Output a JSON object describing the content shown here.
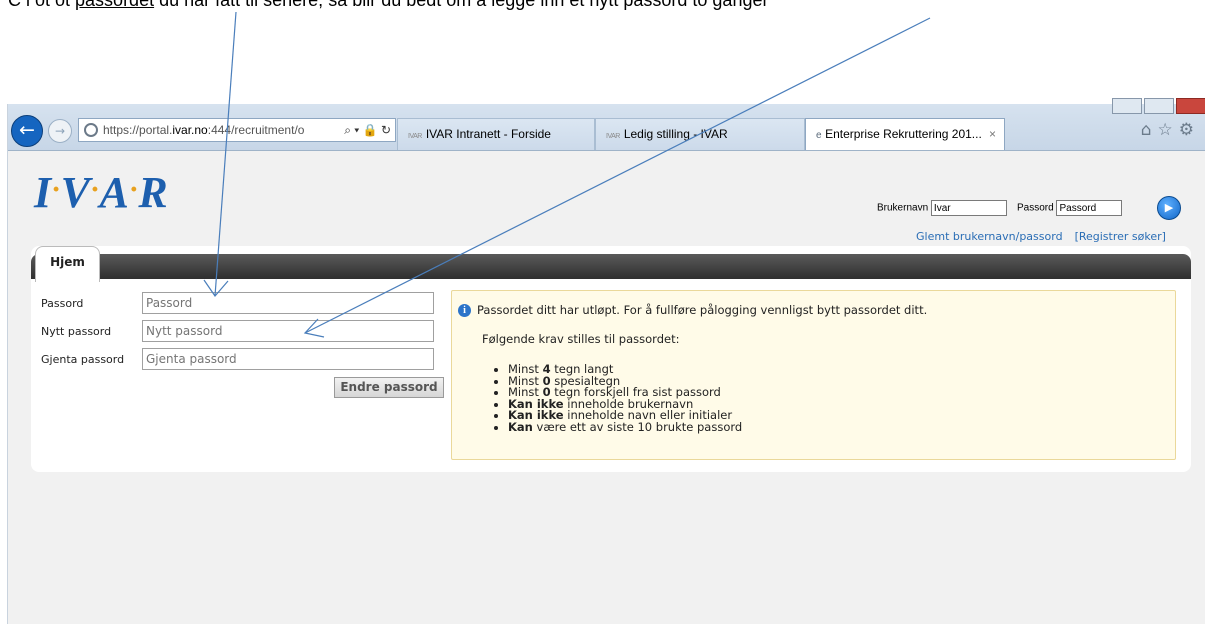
{
  "caption": {
    "before": "C     i     ot ot ",
    "underlined": "passordet",
    "after": " du har fått til senere, så blir du bedt om å legge inn et nytt passord to ganger"
  },
  "browser": {
    "address_prefix": "https://portal.",
    "address_host": "ivar.no",
    "address_suffix": ":444/recruitment/o",
    "address_icons": "⌕ ▾ 🔒 ↻",
    "tabs": [
      {
        "favicon": "IVAR",
        "label": "IVAR Intranett - Forside"
      },
      {
        "favicon": "IVAR",
        "label": "Ledig stilling - IVAR"
      },
      {
        "favicon": "e",
        "label": "Enterprise Rekruttering 201...",
        "close": "×"
      }
    ],
    "toolbar_icons": "⌂☆⚙"
  },
  "header": {
    "logo": [
      "I",
      "V",
      "A",
      "R"
    ],
    "login": {
      "username_label": "Brukernavn",
      "username_value": "Ivar",
      "password_label": "Passord",
      "password_value": "Passord"
    },
    "forgot_link": "Glemt brukernavn/passord",
    "register_link": "[Registrer søker]"
  },
  "nav": {
    "home_tab": "Hjem"
  },
  "form": {
    "fields": [
      {
        "label": "Passord",
        "placeholder": "Passord"
      },
      {
        "label": "Nytt passord",
        "placeholder": "Nytt passord"
      },
      {
        "label": "Gjenta passord",
        "placeholder": "Gjenta passord"
      }
    ],
    "submit": "Endre passord"
  },
  "notice": {
    "icon": "i",
    "message": "Passordet ditt har utløpt. For å fullføre pålogging vennligst bytt passordet ditt.",
    "requirements_title": "Følgende krav stilles til passordet:",
    "requirements": [
      {
        "pre": "Minst ",
        "bold": "4",
        "post": " tegn langt"
      },
      {
        "pre": "Minst ",
        "bold": "0",
        "post": " spesialtegn"
      },
      {
        "pre": "Minst ",
        "bold": "0",
        "post": " tegn forskjell fra sist passord"
      },
      {
        "pre": "",
        "bold": "Kan ikke",
        "post": " inneholde brukernavn"
      },
      {
        "pre": "",
        "bold": "Kan ikke",
        "post": " inneholde navn eller initialer"
      },
      {
        "pre": "",
        "bold": "Kan",
        "post": " være ett av siste 10 brukte passord"
      }
    ]
  },
  "annotation_color": "#4a7ebb"
}
